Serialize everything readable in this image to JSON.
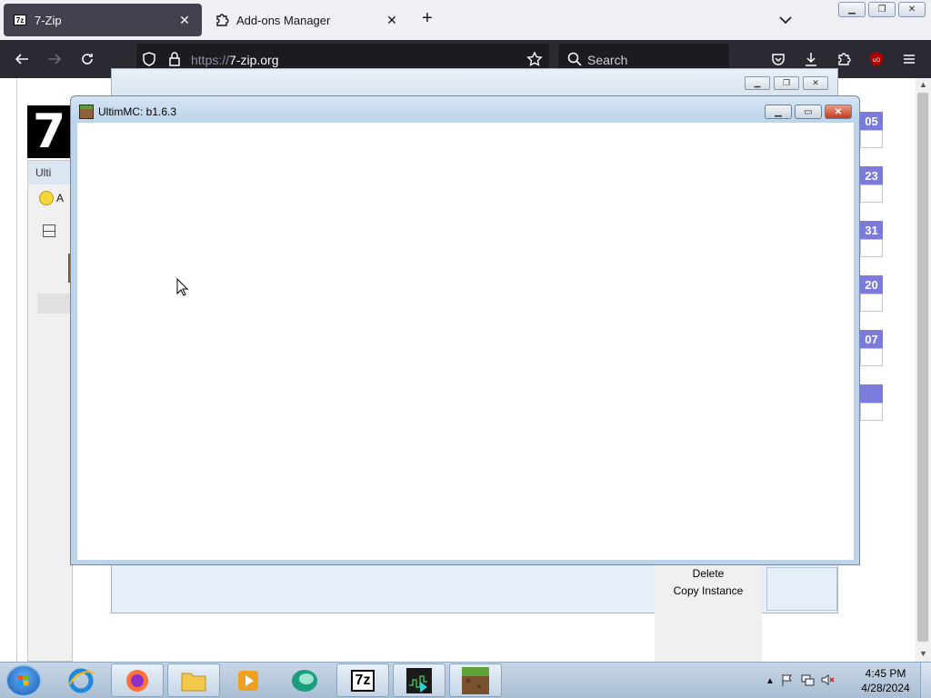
{
  "browser": {
    "tabs": [
      {
        "label": "7-Zip",
        "active": true
      },
      {
        "label": "Add-ons Manager",
        "active": false
      }
    ],
    "url": {
      "scheme": "https://",
      "host": "7-zip.org"
    },
    "search_placeholder": "Search"
  },
  "page": {
    "logo_text": "7",
    "dates": [
      "05",
      "23",
      "31",
      "20",
      "07",
      ""
    ]
  },
  "background_windows": {
    "ultimmc_title_fragment": "Ulti",
    "toolbar_fragment": "A"
  },
  "context_menu": {
    "items": [
      "Delete",
      "Copy Instance"
    ]
  },
  "dialog": {
    "title": "UltimMC: b1.6.3"
  },
  "taskbar": {
    "time": "4:45 PM",
    "date": "4/28/2024",
    "sevenzip_label": "7z"
  },
  "colors": {
    "firefox_dark": "#2b2a33",
    "date_badge": "#7b7bdc",
    "dialog_frame": "#bcd3ea",
    "close_red": "#c23a1d"
  }
}
